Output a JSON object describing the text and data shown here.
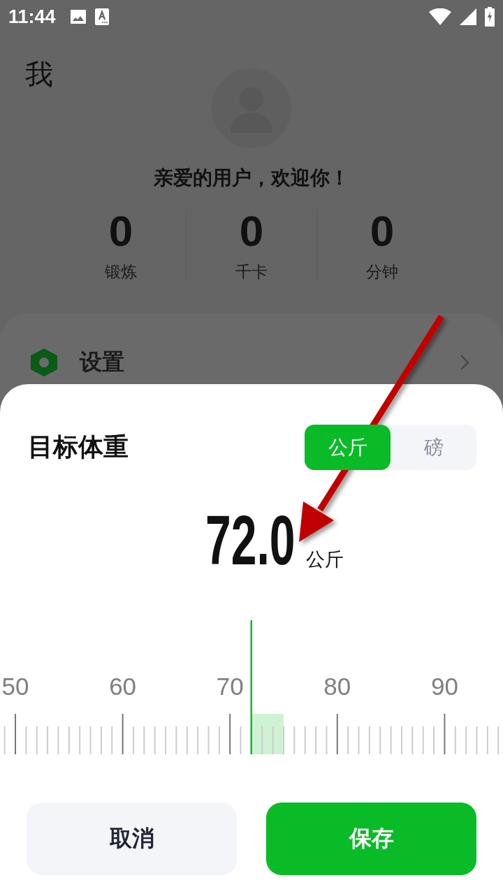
{
  "status_bar": {
    "time": "11:44"
  },
  "page": {
    "title": "我",
    "greeting": "亲爱的用户，欢迎你！",
    "stats": [
      {
        "value": "0",
        "label": "锻炼"
      },
      {
        "value": "0",
        "label": "千卡"
      },
      {
        "value": "0",
        "label": "分钟"
      }
    ],
    "menu": [
      {
        "label": "设置"
      }
    ]
  },
  "sheet": {
    "title": "目标体重",
    "units": [
      {
        "label": "公斤",
        "selected": true
      },
      {
        "label": "磅",
        "selected": false
      }
    ],
    "value": "72.0",
    "unit": "公斤",
    "ruler": {
      "labels": [
        "50",
        "60",
        "70",
        "80",
        "90"
      ]
    },
    "buttons": [
      {
        "label": "取消",
        "kind": "secondary"
      },
      {
        "label": "保存",
        "kind": "primary"
      }
    ]
  }
}
